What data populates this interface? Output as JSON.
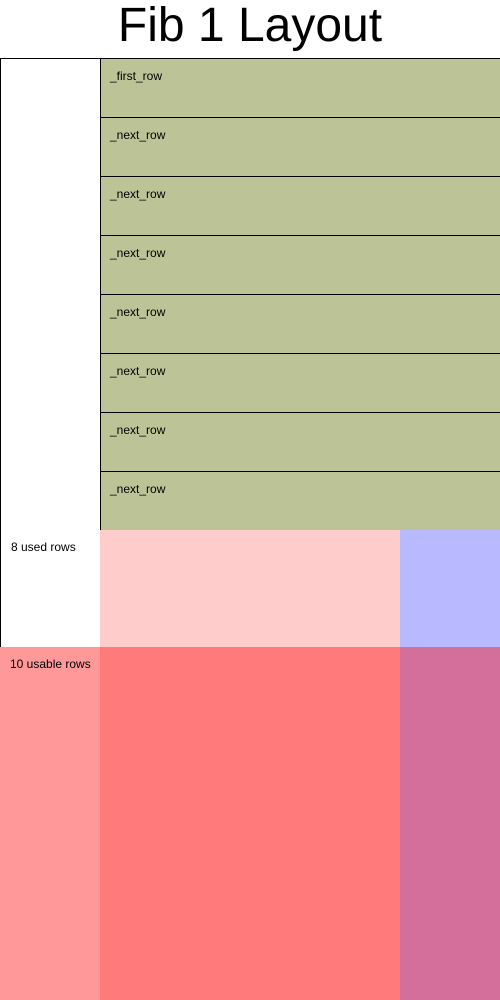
{
  "title": "Fib 1 Layout",
  "rows": [
    {
      "label": "_first_row"
    },
    {
      "label": "_next_row"
    },
    {
      "label": "_next_row"
    },
    {
      "label": "_next_row"
    },
    {
      "label": "_next_row"
    },
    {
      "label": "_next_row"
    },
    {
      "label": "_next_row"
    },
    {
      "label": "_next_row"
    }
  ],
  "used": {
    "label": "8 used rows"
  },
  "usable": {
    "label": "10 usable rows"
  },
  "colors": {
    "row_fill": "#bbc397",
    "used_main": "#ffcccc",
    "used_side": "#b9b9ff",
    "usable_label": "#ff9999",
    "usable_main": "#ff7a7a",
    "usable_side": "#d46e9b"
  }
}
